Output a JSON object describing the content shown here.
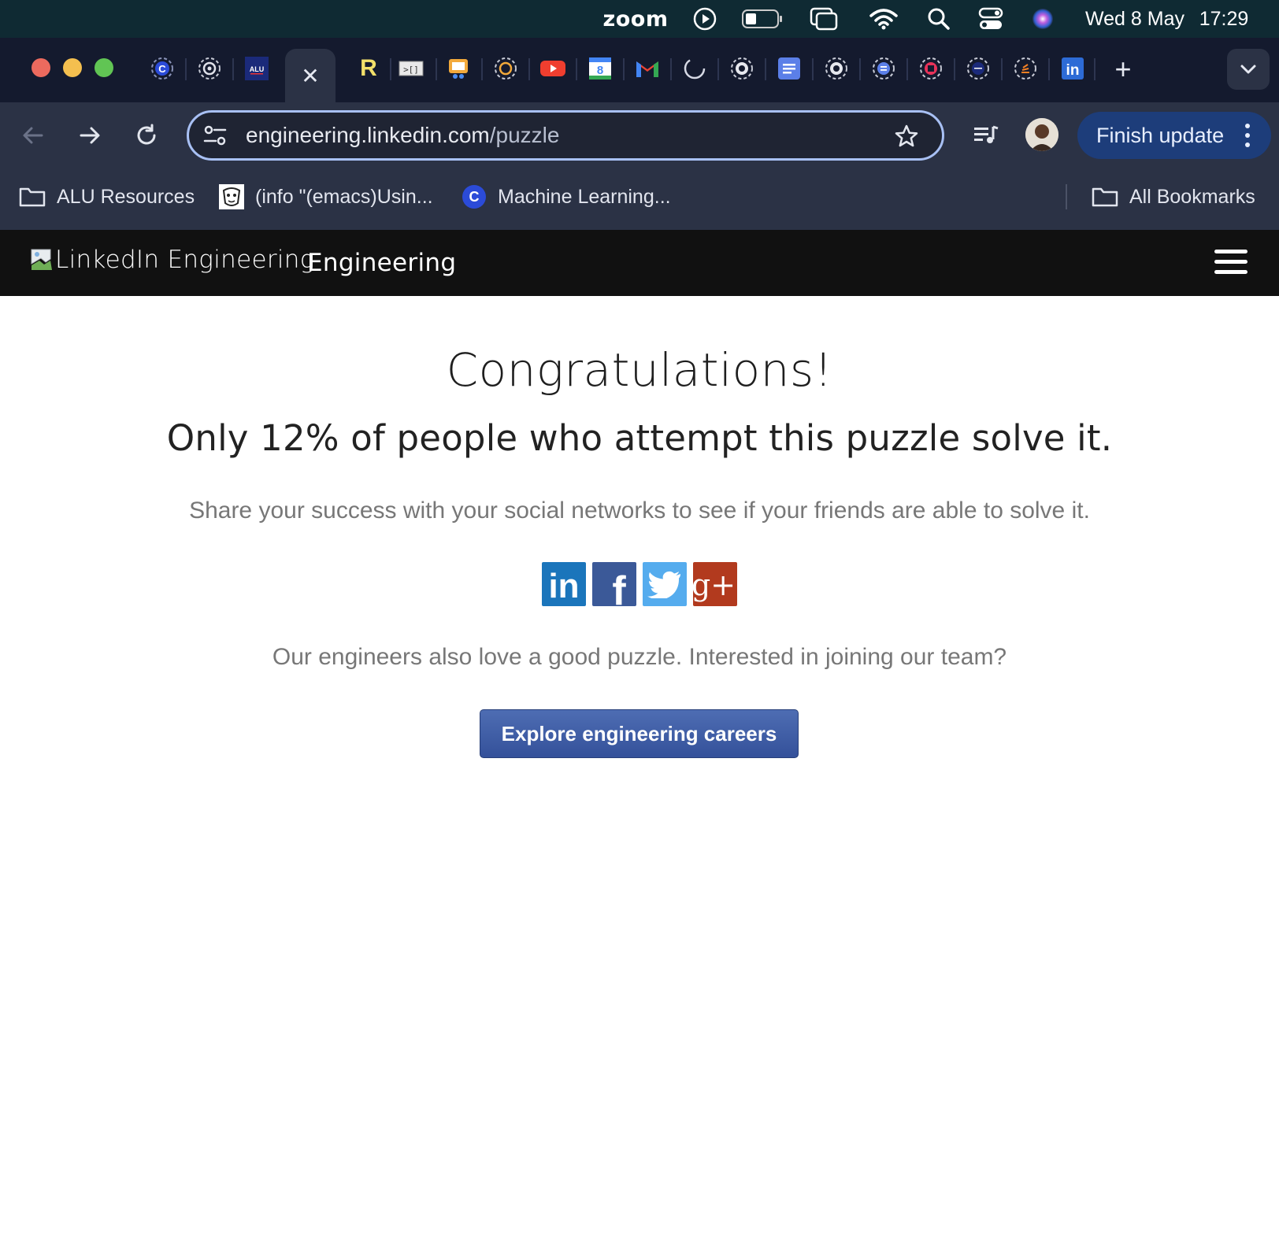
{
  "menubar": {
    "zoom_label": "zoom",
    "date": "Wed 8 May",
    "time": "17:29",
    "icons": [
      "play-circle-icon",
      "battery-icon",
      "screen-mirror-icon",
      "wifi-icon",
      "search-icon",
      "control-center-icon",
      "siri-icon"
    ]
  },
  "tabs": {
    "favicons": [
      "coursera-icon",
      "openai-icon",
      "alu-icon",
      "close-icon",
      "r-icon",
      "code-icon",
      "slides-icon",
      "openai-icon",
      "youtube-icon",
      "calendar-icon",
      "gmail-icon",
      "loading-icon",
      "github-icon",
      "docs-icon",
      "github-icon",
      "openai-icon",
      "app-icon",
      "alu-icon",
      "stackoverflow-icon",
      "linkedin-icon"
    ],
    "alu_badge": "ALU",
    "calendar_day": "8",
    "r_letter": "R",
    "linkedin_letters": "in"
  },
  "toolbar": {
    "url_host": "engineering.linkedin.com",
    "url_path": "/puzzle",
    "finish_update": "Finish update"
  },
  "bookmarks": {
    "items": [
      {
        "label": "ALU Resources",
        "icon": "folder-icon"
      },
      {
        "label": "(info \"(emacs)Usin...",
        "icon": "gnu-icon"
      },
      {
        "label": "Machine Learning...",
        "icon": "coursera-icon"
      }
    ],
    "all_bookmarks": "All Bookmarks"
  },
  "site": {
    "logo_alt": "LinkedIn Engineering",
    "brand": "Engineering"
  },
  "main": {
    "heading": "Congratulations!",
    "subheading": "Only 12% of people who attempt this puzzle solve it.",
    "share_text": "Share your success with your social networks to see if your friends are able to solve it.",
    "social": [
      {
        "name": "linkedin",
        "glyph": "in",
        "color": "#1b75bb"
      },
      {
        "name": "facebook",
        "glyph": "f",
        "color": "#3b5998"
      },
      {
        "name": "twitter",
        "glyph": "",
        "color": "#55acee"
      },
      {
        "name": "google-plus",
        "glyph": "g+",
        "color": "#b23a1e"
      }
    ],
    "careers_text": "Our engineers also love a good puzzle. Interested in joining our team?",
    "cta_label": "Explore engineering careers"
  },
  "colors": {
    "menubar_bg": "#0f2a33",
    "tabstrip_bg": "#141a2e",
    "toolbar_bg": "#2b3245",
    "site_header_bg": "#111111",
    "cta_bg": "#3d5ba6"
  }
}
